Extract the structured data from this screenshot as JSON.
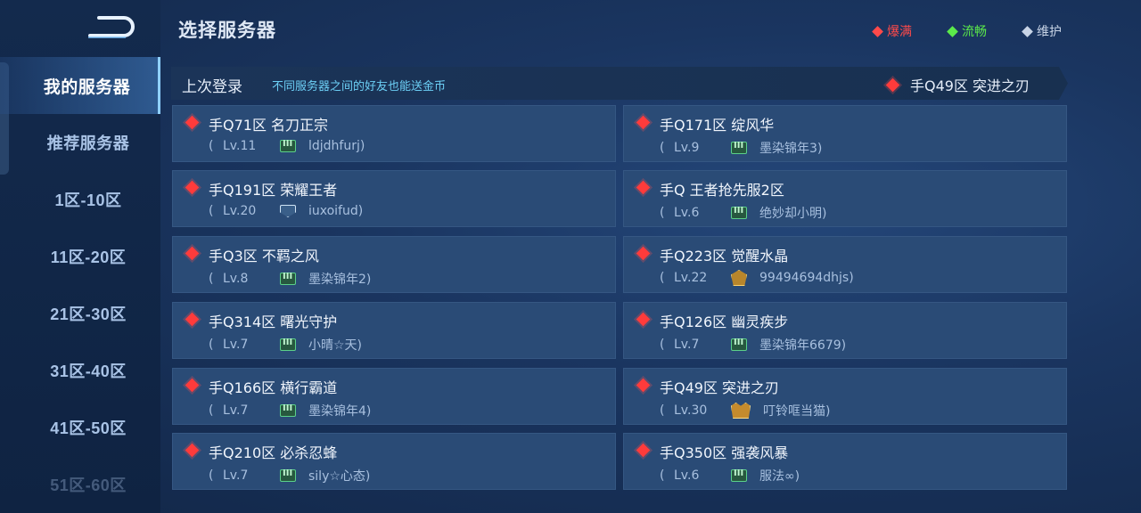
{
  "header": {
    "title": "选择服务器",
    "legend": [
      {
        "label": "爆满",
        "color": "#ff4a4a"
      },
      {
        "label": "流畅",
        "color": "#5bea4a"
      },
      {
        "label": "维护",
        "color": "#c8d4e6"
      }
    ]
  },
  "sidebar": {
    "items": [
      {
        "label": "我的服务器",
        "active": true
      },
      {
        "label": "推荐服务器"
      },
      {
        "label": "1区-10区"
      },
      {
        "label": "11区-20区"
      },
      {
        "label": "21区-30区"
      },
      {
        "label": "31区-40区"
      },
      {
        "label": "41区-50区"
      },
      {
        "label": "51区-60区"
      }
    ]
  },
  "last_login": {
    "label": "上次登录",
    "tip": "不同服务器之间的好友也能送金币",
    "server": "手Q49区 突进之刃"
  },
  "servers": [
    {
      "name": "手Q71区 名刀正宗",
      "level": "Lv.11",
      "rank": "green",
      "player": "ldjdhfurj)"
    },
    {
      "name": "手Q171区 绽风华",
      "level": "Lv.9",
      "rank": "green",
      "player": "墨染锦年3)"
    },
    {
      "name": "手Q191区 荣耀王者",
      "level": "Lv.20",
      "rank": "silver",
      "player": "iuxoifud)"
    },
    {
      "name": "手Q 王者抢先服2区",
      "level": "Lv.6",
      "rank": "green",
      "player": "绝妙却小明)"
    },
    {
      "name": "手Q3区 不羁之风",
      "level": "Lv.8",
      "rank": "green",
      "player": "墨染锦年2)"
    },
    {
      "name": "手Q223区 觉醒水晶",
      "level": "Lv.22",
      "rank": "gold",
      "player": "99494694dhjs)"
    },
    {
      "name": "手Q314区 曙光守护",
      "level": "Lv.7",
      "rank": "green",
      "player": "小晴☆天)"
    },
    {
      "name": "手Q126区 幽灵疾步",
      "level": "Lv.7",
      "rank": "green",
      "player": "墨染锦年6679)"
    },
    {
      "name": "手Q166区 横行霸道",
      "level": "Lv.7",
      "rank": "green",
      "player": "墨染锦年4)"
    },
    {
      "name": "手Q49区 突进之刃",
      "level": "Lv.30",
      "rank": "king",
      "player": "叮铃哐当猫)"
    },
    {
      "name": "手Q210区 必杀忍蜂",
      "level": "Lv.7",
      "rank": "green",
      "player": "sily☆心态)"
    },
    {
      "name": "手Q350区 强袭风暴",
      "level": "Lv.6",
      "rank": "green",
      "player": "服法∞)"
    }
  ],
  "paren_open": "("
}
